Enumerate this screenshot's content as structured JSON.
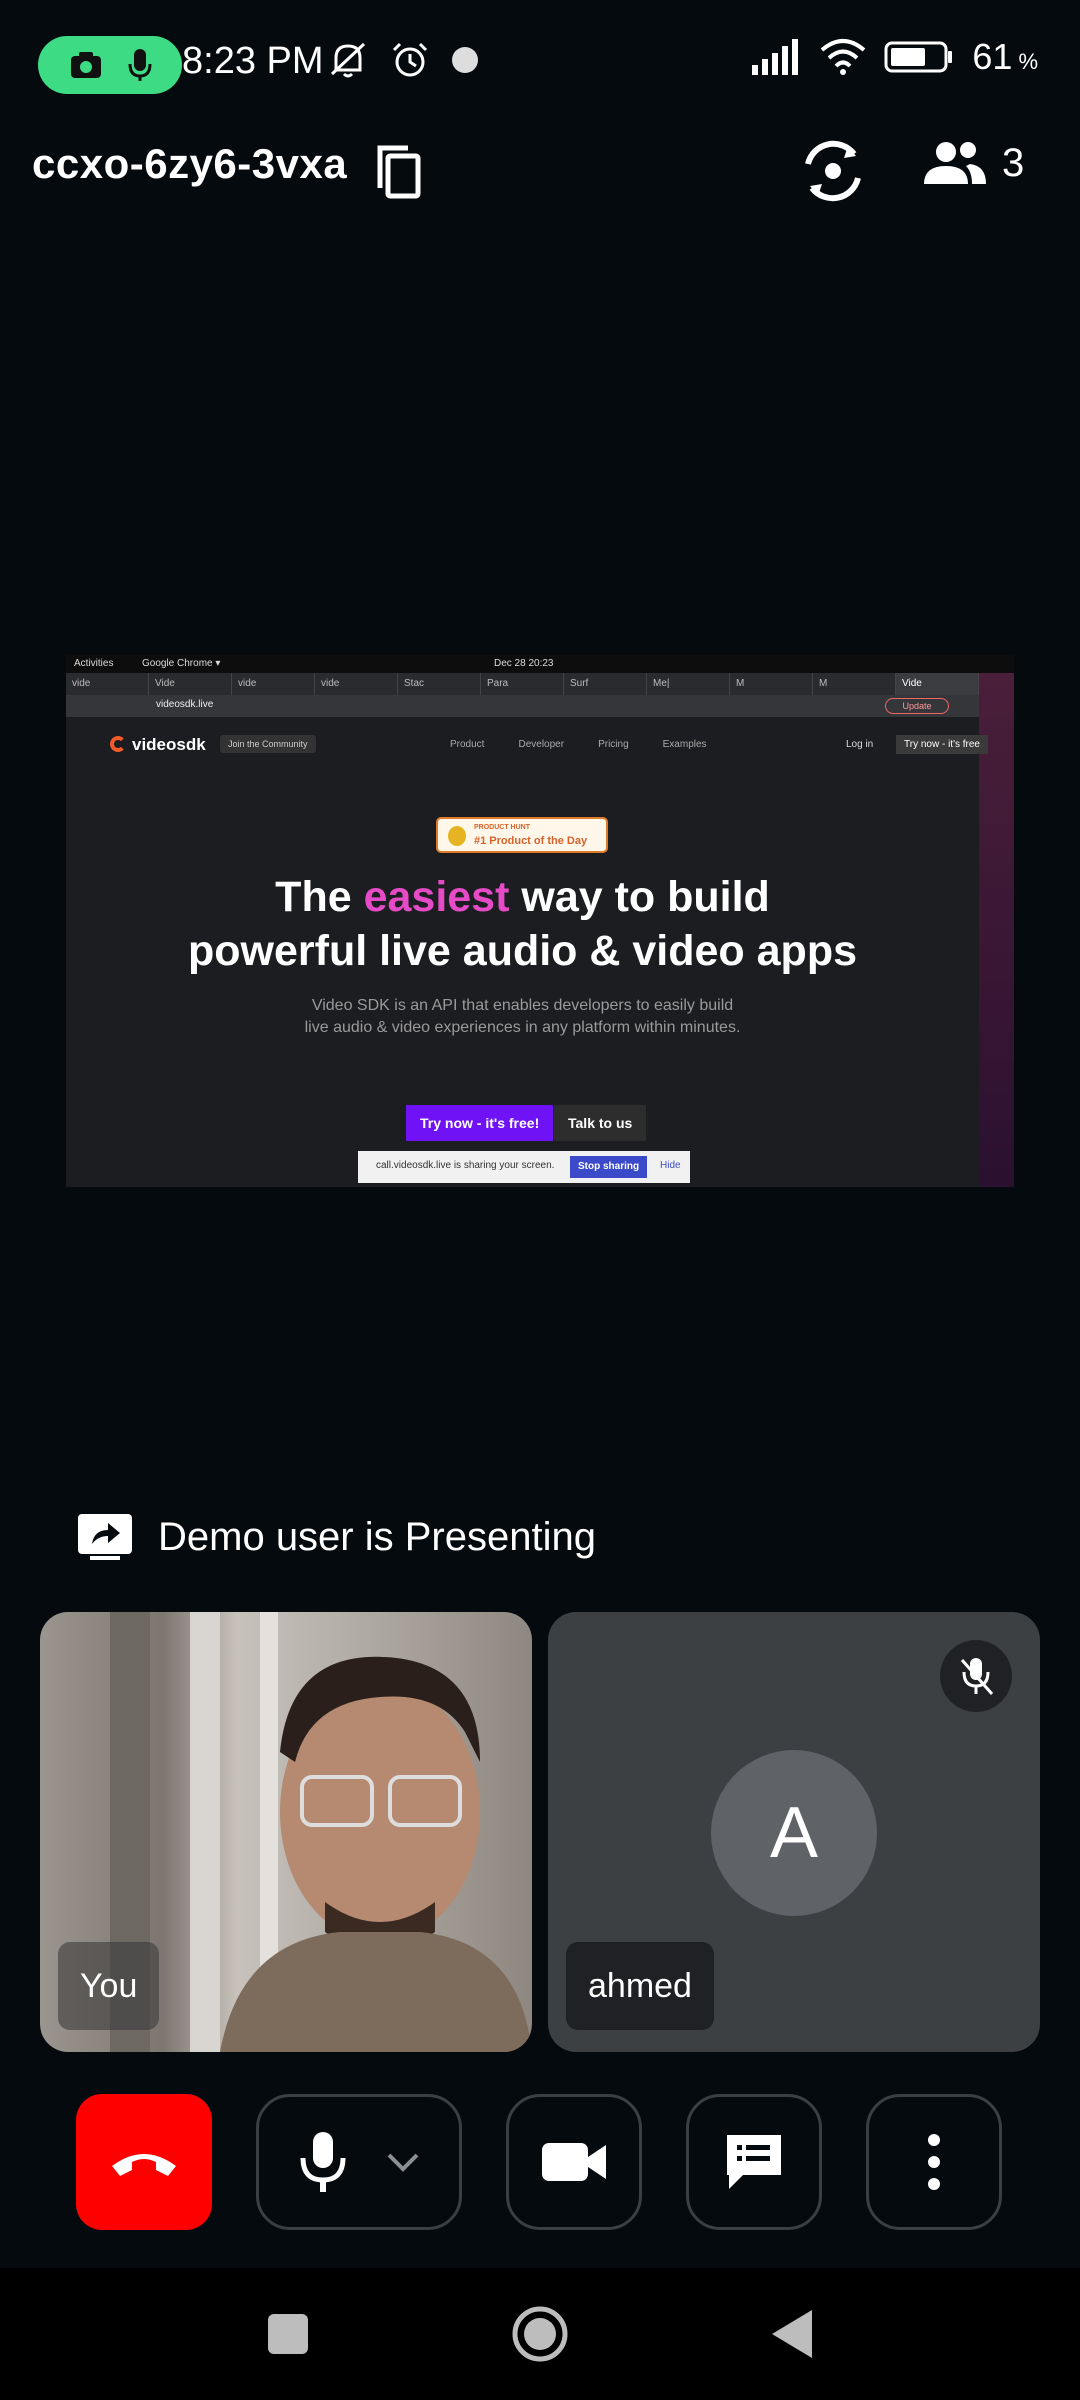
{
  "status_bar": {
    "time": "8:23 PM",
    "battery_percent": "61",
    "battery_unit": "%",
    "icons": [
      "camera-icon",
      "mic-icon",
      "mute-bell-icon",
      "alarm-icon",
      "dot-icon",
      "signal-icon",
      "wifi-icon",
      "battery-icon"
    ]
  },
  "header": {
    "meeting_id": "ccxo-6zy6-3vxa",
    "participant_count": "3"
  },
  "shared_screen": {
    "system_topbar": {
      "activities": "Activities",
      "app": "Google Chrome ▾",
      "datetime": "Dec 28  20:23"
    },
    "tabs": [
      "vide",
      "Vide",
      "vide",
      "vide",
      "Stac",
      "Para",
      "Surf",
      "Me|",
      "M",
      "M",
      "Vide"
    ],
    "url": "videosdk.live",
    "update_label": "Update",
    "site": {
      "logo": "videosdk",
      "community": "Join the Community",
      "nav_links": [
        "Product",
        "Developer",
        "Pricing",
        "Examples"
      ],
      "login": "Log in",
      "nav_cta": "Try now - it's free",
      "badge_small": "PRODUCT HUNT",
      "badge_big": "#1 Product of the Day",
      "headline_pre": "The ",
      "headline_highlight": "easiest",
      "headline_post": " way to build",
      "headline_line2": "powerful live audio & video apps",
      "subtitle_line1": "Video SDK is an API that enables developers to easily build",
      "subtitle_line2": "live audio & video experiences in any platform within minutes.",
      "cta_primary": "Try now - it's free!",
      "cta_secondary": "Talk to us"
    },
    "share_bar": {
      "text": "call.videosdk.live is sharing your screen.",
      "stop": "Stop sharing",
      "hide": "Hide"
    }
  },
  "presenting_label": "Demo user is Presenting",
  "participants": [
    {
      "name": "You",
      "video_on": true
    },
    {
      "name": "ahmed",
      "initial": "A",
      "video_on": false,
      "muted": true
    }
  ],
  "colors": {
    "background": "#050a0e",
    "end_call": "#ff0000",
    "tile_bg": "#3c4043",
    "avatar_bg": "#5f6368",
    "status_pill": "#3ddc84"
  }
}
